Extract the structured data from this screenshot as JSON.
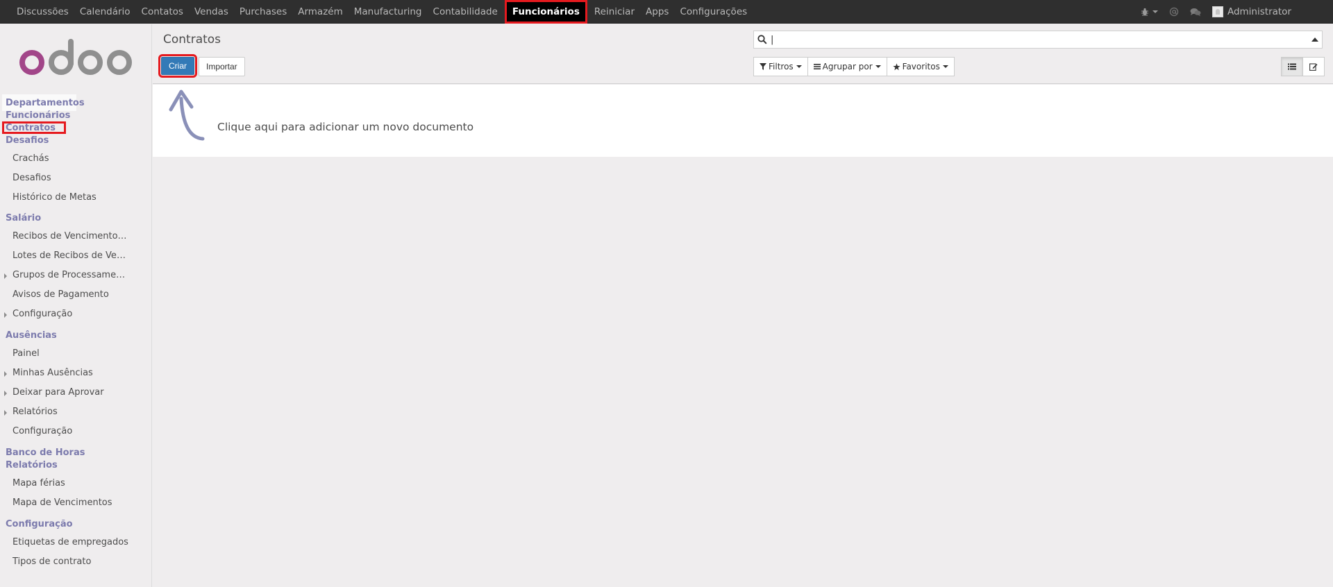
{
  "topbar": {
    "menu": [
      {
        "label": "Discussões",
        "active": false
      },
      {
        "label": "Calendário",
        "active": false
      },
      {
        "label": "Contatos",
        "active": false
      },
      {
        "label": "Vendas",
        "active": false
      },
      {
        "label": "Purchases",
        "active": false
      },
      {
        "label": "Armazém",
        "active": false
      },
      {
        "label": "Manufacturing",
        "active": false
      },
      {
        "label": "Contabilidade",
        "active": false
      },
      {
        "label": "Funcionários",
        "active": true
      },
      {
        "label": "Reiniciar",
        "active": false
      },
      {
        "label": "Apps",
        "active": false
      },
      {
        "label": "Configurações",
        "active": false
      }
    ],
    "user_name": "Administrator",
    "icons": [
      "bug-icon",
      "at-icon",
      "chat-icon"
    ]
  },
  "sidebar": {
    "logo_text": "odoo",
    "sections": {
      "departamentos": "Departamentos",
      "funcionarios": "Funcionários",
      "contratos": "Contratos",
      "desafios": "Desafios",
      "salario": "Salário",
      "ausencias": "Ausências",
      "banco_horas": "Banco de Horas",
      "relatorios": "Relatórios",
      "configuracao": "Configuração"
    },
    "desafios_items": [
      "Crachás",
      "Desafios",
      "Histórico de Metas"
    ],
    "salario_items": [
      "Recibos de Vencimento d...",
      "Lotes de Recibos de Venci...",
      "Grupos de Processamento",
      "Avisos de Pagamento",
      "Configuração"
    ],
    "ausencias_items": [
      "Painel",
      "Minhas Ausências",
      "Deixar para Aprovar",
      "Relatórios",
      "Configuração"
    ],
    "relatorios_items": [
      "Mapa férias",
      "Mapa de Vencimentos"
    ],
    "configuracao_items": [
      "Etiquetas de empregados",
      "Tipos de contrato"
    ]
  },
  "control_panel": {
    "breadcrumb": "Contratos",
    "search_value": "|",
    "create_label": "Criar",
    "import_label": "Importar",
    "filters_label": "Filtros",
    "groupby_label": "Agrupar por",
    "favorites_label": "Favoritos"
  },
  "helper": {
    "message": "Clique aqui para adicionar um novo documento"
  },
  "colors": {
    "topbar": "#2f2f2f",
    "accent": "#7c7bad",
    "primary": "#337ab7",
    "highlight": "#e51a1f",
    "logo_o": "#a24689",
    "logo_grey": "#8f8f8f"
  }
}
